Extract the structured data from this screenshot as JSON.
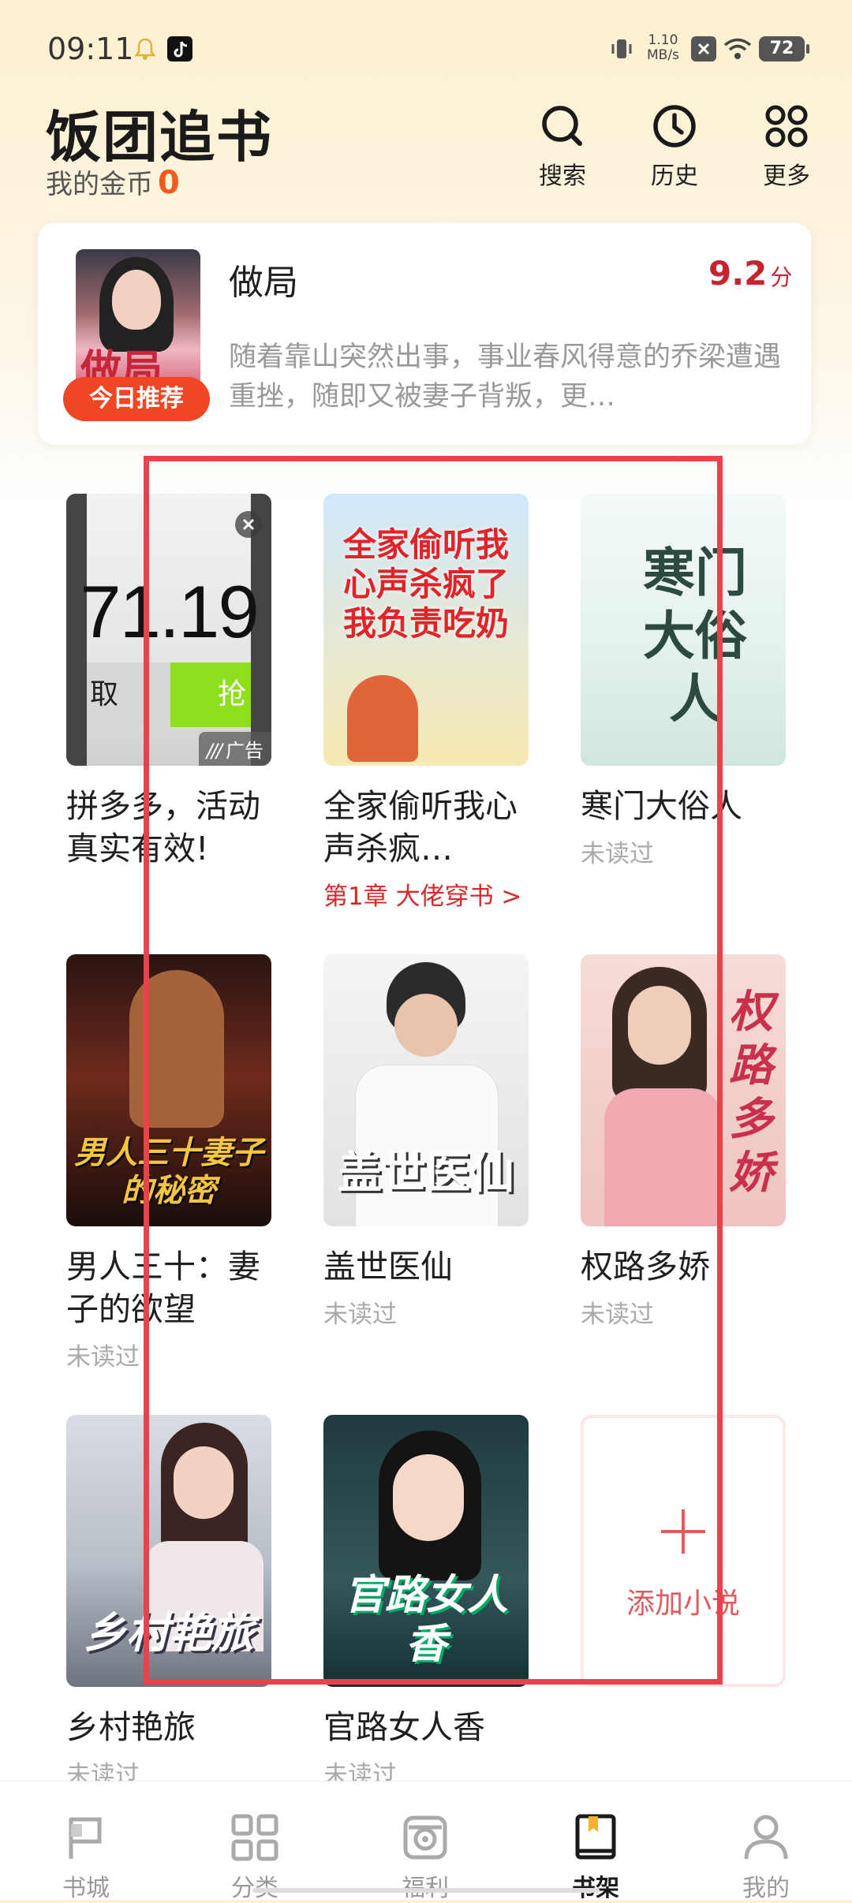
{
  "status_bar": {
    "time": "09:11",
    "net_speed": "1.10",
    "net_unit": "MB/s",
    "battery": "72"
  },
  "header": {
    "title": "饭团追书",
    "coins_label": "我的金币",
    "coins_value": "0",
    "buttons": [
      {
        "label": "搜索",
        "icon": "search-icon"
      },
      {
        "label": "历史",
        "icon": "clock-icon"
      },
      {
        "label": "更多",
        "icon": "grid-icon"
      }
    ]
  },
  "recommend": {
    "badge": "今日推荐",
    "cover_text": "做局",
    "title": "做局",
    "score": "9.2",
    "score_unit": "分",
    "description": "随着靠山突然出事，事业春风得意的乔梁遭遇重挫，随即又被妻子背叛，更…"
  },
  "ad": {
    "number": "71.19",
    "left_text": "取",
    "right_text": "抢",
    "label": "广告",
    "title": "拼多多，活动真实有效!"
  },
  "books": [
    {
      "title": "全家偷听我心声杀疯…",
      "cover_text": "全家偷听我心声杀疯了我负责吃奶",
      "sub": "第1章 大佬穿书 >"
    },
    {
      "title": "寒门大俗人",
      "cover_text": "寒门大俗人",
      "sub": "未读过"
    },
    {
      "title": "男人三十：妻子的欲望",
      "cover_text": "男人三十妻子的秘密",
      "sub": "未读过"
    },
    {
      "title": "盖世医仙",
      "cover_text": "盖世医仙",
      "sub": "未读过"
    },
    {
      "title": "权路多娇",
      "cover_text": "权路多娇",
      "sub": "未读过"
    },
    {
      "title": "乡村艳旅",
      "cover_text": "乡村艳旅",
      "sub": "未读过"
    },
    {
      "title": "官路女人香",
      "cover_text": "官路女人香",
      "sub": "未读过"
    }
  ],
  "add_novel": {
    "label": "添加小说",
    "icon": "plus-icon"
  },
  "nav": [
    {
      "label": "书城",
      "icon": "flag-icon",
      "active": false
    },
    {
      "label": "分类",
      "icon": "category-grid-icon",
      "active": false
    },
    {
      "label": "福利",
      "icon": "gift-icon",
      "active": false
    },
    {
      "label": "书架",
      "icon": "bookshelf-icon",
      "active": true
    },
    {
      "label": "我的",
      "icon": "profile-icon",
      "active": false
    }
  ],
  "colors": {
    "accent_red": "#d8292a",
    "badge_orange": "#f04623",
    "coin_orange": "#f05a1a",
    "annotation_red": "#e8424a"
  }
}
